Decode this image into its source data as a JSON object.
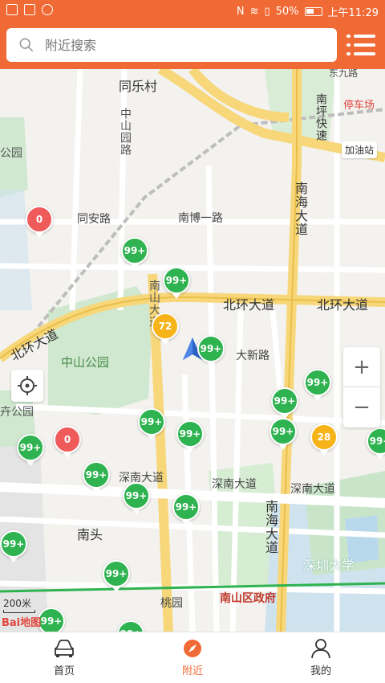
{
  "status_bar": {
    "nfc": "N",
    "battery": "50%",
    "time": "上午11:29"
  },
  "search": {
    "placeholder": "附近搜索"
  },
  "map": {
    "labels": {
      "tongle_village": "同乐村",
      "zhongshan_garden": "中山园路",
      "tongan_road": "同安路",
      "nanbo_road": "南博一路",
      "nanhai_avenue": "南海大道",
      "beihuan_avenue_1": "北环大道",
      "beihuan_avenue_2": "北环大道",
      "beihuan_avenue_3": "北环大道",
      "nanshan_avenue": "南山大道",
      "zhongshan_park": "中山公园",
      "daxin_road": "大新路",
      "shennan_avenue_1": "深南大道",
      "shennan_avenue_2": "深南大道",
      "shennan_avenue_3": "深南大道",
      "nanhai_avenue_2": "南海大道",
      "nantou": "南头",
      "shenzhen_university": "深圳大学",
      "nanshan_gov": "南山区政府",
      "taoyuan": "桃园",
      "park_left": "公园",
      "qi_park": "卉公园",
      "parking": "停车场",
      "gas_station": "加油站",
      "north_road": "南坪快速",
      "road_east": "东九路"
    },
    "pins": [
      {
        "id": "p1",
        "label": "0",
        "color": "red"
      },
      {
        "id": "p2",
        "label": "99+",
        "color": "green"
      },
      {
        "id": "p3",
        "label": "99+",
        "color": "green"
      },
      {
        "id": "p4",
        "label": "72",
        "color": "yellow"
      },
      {
        "id": "p5",
        "label": "99+",
        "color": "green"
      },
      {
        "id": "p6",
        "label": "99+",
        "color": "green"
      },
      {
        "id": "p7",
        "label": "99+",
        "color": "green"
      },
      {
        "id": "p8",
        "label": "99+",
        "color": "green"
      },
      {
        "id": "p9",
        "label": "99+",
        "color": "green"
      },
      {
        "id": "p10",
        "label": "28",
        "color": "yellow"
      },
      {
        "id": "p11",
        "label": "99+",
        "color": "green"
      },
      {
        "id": "p12",
        "label": "99+",
        "color": "green"
      },
      {
        "id": "p13",
        "label": "0",
        "color": "red"
      },
      {
        "id": "p14",
        "label": "99+",
        "color": "green"
      },
      {
        "id": "p15",
        "label": "99+",
        "color": "green"
      },
      {
        "id": "p16",
        "label": "99+",
        "color": "green"
      },
      {
        "id": "p17",
        "label": "99+",
        "color": "green"
      },
      {
        "id": "p18",
        "label": "99+",
        "color": "green"
      },
      {
        "id": "p19",
        "label": "99+",
        "color": "green"
      },
      {
        "id": "p20",
        "label": "99+",
        "color": "green"
      },
      {
        "id": "p21",
        "label": "99+",
        "color": "green"
      }
    ],
    "zoom_in": "+",
    "zoom_out": "−",
    "scale": "200米",
    "logo": "Bai地图"
  },
  "nav": {
    "home": "首页",
    "nearby": "附近",
    "mine": "我的"
  },
  "colors": {
    "accent": "#f06a35",
    "green": "#2fb350",
    "yellow": "#f6b418",
    "red": "#ef5a5a"
  }
}
